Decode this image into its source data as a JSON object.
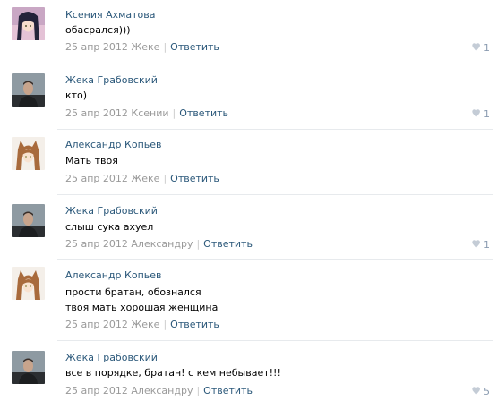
{
  "comments": [
    {
      "author": "Ксения Ахматова",
      "text": [
        "обасрался)))"
      ],
      "date": "25 апр 2012",
      "to": "Жеке",
      "reply": "Ответить",
      "likes": "1",
      "avatar": "anime-girl-dark"
    },
    {
      "author": "Жека Грабовский",
      "text": [
        "кто)"
      ],
      "date": "25 апр 2012",
      "to": "Ксении",
      "reply": "Ответить",
      "likes": "1",
      "avatar": "man-photo"
    },
    {
      "author": "Александр Копьев",
      "text": [
        "Мать твоя"
      ],
      "date": "25 апр 2012",
      "to": "Жеке",
      "reply": "Ответить",
      "likes": "",
      "avatar": "anime-wolf-girl"
    },
    {
      "author": "Жека Грабовский",
      "text": [
        "слыш сука ахуел"
      ],
      "date": "25 апр 2012",
      "to": "Александру",
      "reply": "Ответить",
      "likes": "1",
      "avatar": "man-photo"
    },
    {
      "author": "Александр Копьев",
      "text": [
        "прости братан, обознался",
        "твоя мать хорошая женщина"
      ],
      "date": "25 апр 2012",
      "to": "Жеке",
      "reply": "Ответить",
      "likes": "",
      "avatar": "anime-wolf-girl"
    },
    {
      "author": "Жека Грабовский",
      "text": [
        "все в порядке, братан! с кем небывает!!!"
      ],
      "date": "25 апр 2012",
      "to": "Александру",
      "reply": "Ответить",
      "likes": "5",
      "avatar": "man-photo"
    }
  ]
}
